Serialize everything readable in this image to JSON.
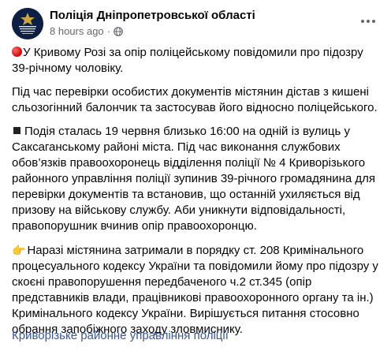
{
  "header": {
    "page_name": "Поліція Дніпропетровської області",
    "time": "8 hours ago",
    "separator": "·",
    "avatar_icon": "police-emblem-icon",
    "privacy_icon": "globe-icon",
    "more_icon": "more-options-icon"
  },
  "post": {
    "p1_text": "У Кривому Розі за опір поліцейському повідомили про підозру 39-річному чоловіку.",
    "p1_icon": "red-circle-icon",
    "p2_text": "Під час перевірки особистих документів містянин дістав з кишені сльозогінний балончик та застосував його відносно поліцейського.",
    "p3_text": "Подія сталась 19 червня близько 16:00 на одній із вулиць у Саксаганському районі міста. Під час виконання службових обов’язків правоохоронець відділення поліції № 4 Криворізького районного управління поліції зупинив 39-річного громадянина для перевірки документів та встановив, що останній ухиляється від призову на військову службу. Аби уникнути відповідальності, правопорушник вчинив опір правоохоронцю.",
    "p3_icon": "black-square-icon",
    "p4_text": "Наразі містянина затримали в порядку ст. 208 Кримінального процесуального кодексу України та повідомили йому про підозру у скоєні правопорушення передбаченого ч.2 ст.345 (опір представників влади, працівникові правоохоронного органу та ін.) Кримінального кодексу України. Вирішується питання стосовно обрання запобіжного заходу зловмиснику.",
    "p4_icon": "pointing-hand-icon"
  },
  "footer": {
    "link_text": "Криворізьке районне управління поліції"
  },
  "colors": {
    "link": "#385898",
    "meta": "#65676b",
    "text": "#050505"
  }
}
